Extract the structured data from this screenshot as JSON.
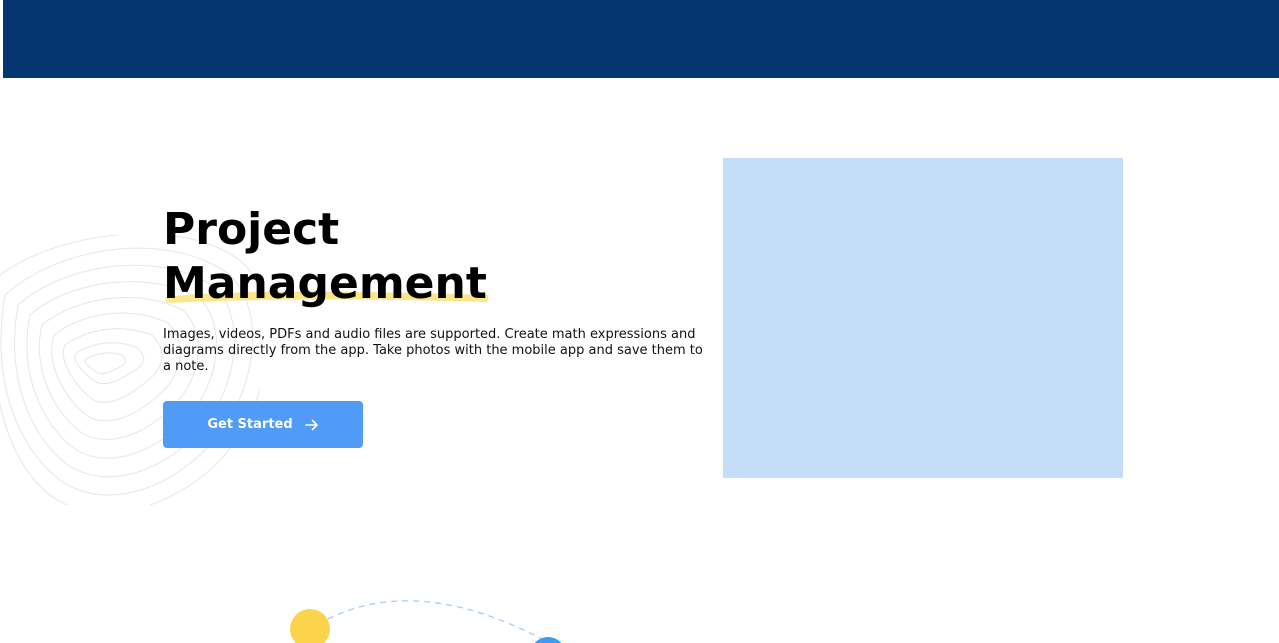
{
  "header": {
    "background_color": "#053672"
  },
  "hero": {
    "title_line1": "Project",
    "title_line2": "Management",
    "description": "Images, videos, PDFs and audio files are supported. Create math expressions and diagrams directly from the app. Take photos with the mobile app and save them to a note.",
    "cta_label": "Get Started",
    "cta_icon": "arrow-right-icon",
    "accent_color": "#4f9bf6",
    "highlight_color": "#fde68a"
  },
  "media": {
    "placeholder_color": "#c4defa"
  },
  "decorations": {
    "contour_icon": "contour-lines-icon",
    "yellow_dot_color": "#fcd34d",
    "blue_dot_color": "#3b9cf6"
  }
}
